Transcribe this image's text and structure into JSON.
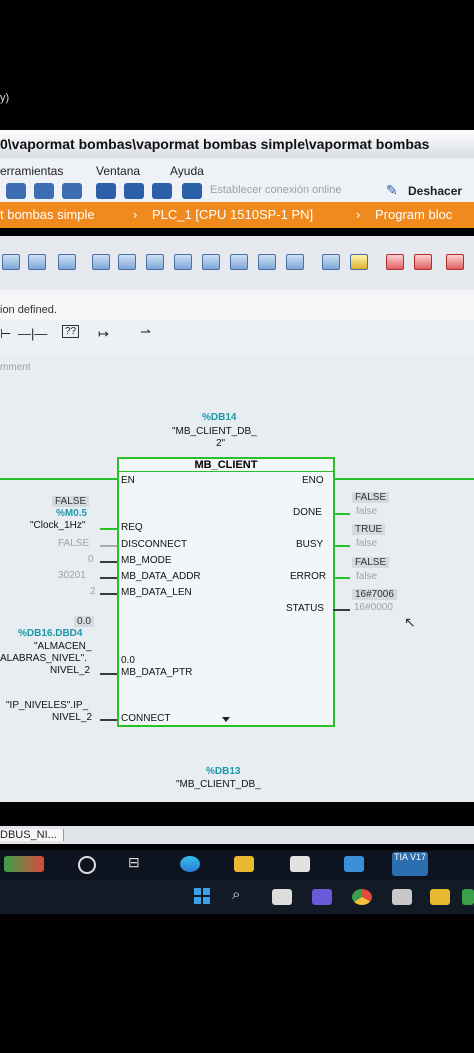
{
  "top_fragment": "y)",
  "window": {
    "title": "0\\vapormat bombas\\vapormat bombas simple\\vapormat bombas"
  },
  "menu": {
    "items": [
      "erramientas",
      "Ventana",
      "Ayuda"
    ],
    "online_label": "Establecer conexión online",
    "undo_label": "Deshacer"
  },
  "breadcrumb": {
    "items": [
      "t bombas simple",
      "PLC_1 [CPU 1510SP-1 PN]",
      "Program bloc"
    ]
  },
  "info": {
    "text": "ion defined.",
    "comment": "mment"
  },
  "block": {
    "instance_ref": "%DB14",
    "instance_name_1": "\"MB_CLIENT_DB_",
    "instance_name_2": "2\"",
    "name": "MB_CLIENT",
    "inputs": {
      "en": "EN",
      "req": "REQ",
      "disconnect": "DISCONNECT",
      "mb_mode": "MB_MODE",
      "mb_data_addr": "MB_DATA_ADDR",
      "mb_data_len": "MB_DATA_LEN",
      "mb_data_ptr": "MB_DATA_PTR",
      "connect": "CONNECT"
    },
    "outputs": {
      "eno": "ENO",
      "done": "DONE",
      "busy": "BUSY",
      "error": "ERROR",
      "status": "STATUS"
    },
    "input_values": {
      "req_monitor": "FALSE",
      "req_address": "%M0.5",
      "req_symbol": "\"Clock_1Hz\"",
      "disconnect_value": "FALSE",
      "mb_mode_value": "0",
      "mb_data_addr_value": "30201",
      "mb_data_len_value": "2",
      "ptr_monitor": "0.0",
      "ptr_address": "%DB16.DBD4",
      "ptr_symbol_1": "\"ALMACEN_",
      "ptr_symbol_2": "ALABRAS_NIVEL\".",
      "ptr_symbol_3": "NIVEL_2",
      "ptr_inner": "0.0",
      "connect_symbol_1": "\"IP_NIVELES\".IP_",
      "connect_symbol_2": "NIVEL_2"
    },
    "output_values": {
      "done_monitor": "FALSE",
      "done_value": "false",
      "busy_monitor": "TRUE",
      "busy_value": "false",
      "error_monitor": "FALSE",
      "error_value": "false",
      "status_monitor": "16#7006",
      "status_value": "16#0000"
    }
  },
  "block2": {
    "instance_ref": "%DB13",
    "instance_name": "\"MB_CLIENT_DB_"
  },
  "statusbar": {
    "tab": "DBUS_NI..."
  },
  "colors": {
    "title_orange": "#f08a1e",
    "wire_green": "#2ac02a",
    "teal": "#1a9aa8"
  },
  "icons": [
    "windows-start-icon",
    "search-icon",
    "file-explorer-icon",
    "chrome-icon",
    "tia-portal-icon"
  ],
  "tia_label": "TIA V17"
}
